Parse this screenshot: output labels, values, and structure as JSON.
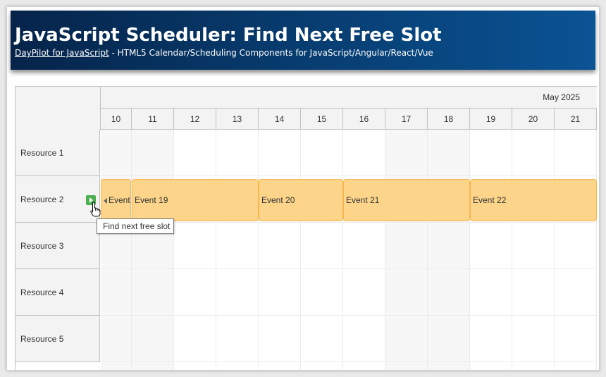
{
  "header": {
    "title": "JavaScript Scheduler: Find Next Free Slot",
    "link_text": "DayPilot for JavaScript",
    "subtitle_rest": " - HTML5 Calendar/Scheduling Components for JavaScript/Angular/React/Vue"
  },
  "scheduler": {
    "month_label": "May 2025",
    "days": [
      "10",
      "11",
      "12",
      "13",
      "14",
      "15",
      "16",
      "17",
      "18",
      "19",
      "20",
      "21"
    ],
    "resources": [
      "Resource 1",
      "Resource 2",
      "Resource 3",
      "Resource 4",
      "Resource 5"
    ],
    "events": [
      {
        "label": "Event",
        "continued": true
      },
      {
        "label": "Event 19"
      },
      {
        "label": "Event 20"
      },
      {
        "label": "Event 21"
      },
      {
        "label": "Event 22"
      }
    ],
    "find_free_slot_icon": "play-arrow-icon",
    "tooltip": "Find next free slot"
  },
  "colors": {
    "header_dark": "#06244a",
    "header_light": "#0a5394",
    "event_fill": "#fdd58a",
    "event_border": "#f3b64f",
    "button_green": "#4caf50"
  }
}
